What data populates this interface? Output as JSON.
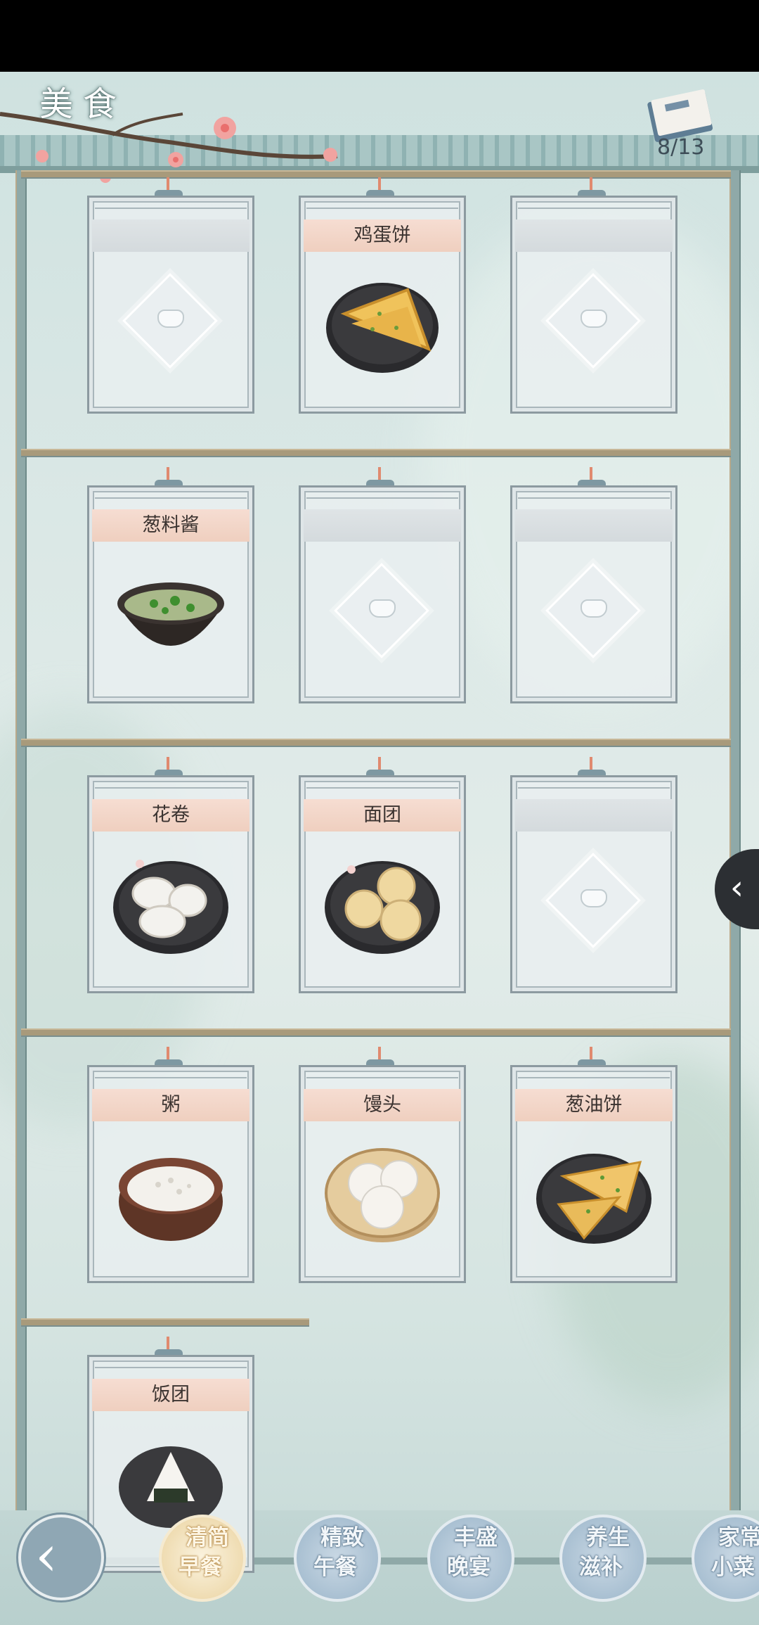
{
  "header": {
    "title": "美食",
    "progress": "8/13"
  },
  "cards": [
    {
      "name": "",
      "dish": "unknown"
    },
    {
      "name": "鸡蛋饼",
      "dish": "egg-pancake"
    },
    {
      "name": "",
      "dish": "unknown"
    },
    {
      "name": "葱料酱",
      "dish": "scallion-sauce"
    },
    {
      "name": "",
      "dish": "unknown"
    },
    {
      "name": "",
      "dish": "unknown"
    },
    {
      "name": "花卷",
      "dish": "flower-roll"
    },
    {
      "name": "面团",
      "dish": "dough"
    },
    {
      "name": "",
      "dish": "unknown"
    },
    {
      "name": "粥",
      "dish": "porridge"
    },
    {
      "name": "馒头",
      "dish": "steamed-bun"
    },
    {
      "name": "葱油饼",
      "dish": "scallion-pancake"
    },
    {
      "name": "饭团",
      "dish": "rice-ball"
    }
  ],
  "side_tab": {
    "icon": "chevron-left-icon"
  },
  "nav": {
    "back_icon": "back-arrow-icon",
    "tabs": [
      {
        "line1": "清简",
        "line2": "早餐",
        "selected": true
      },
      {
        "line1": "精致",
        "line2": "午餐",
        "selected": false
      },
      {
        "line1": "丰盛",
        "line2": "晚宴",
        "selected": false
      },
      {
        "line1": "养生",
        "line2": "滋补",
        "selected": false
      },
      {
        "line1": "家常",
        "line2": "小菜",
        "selected": false
      }
    ]
  },
  "colors": {
    "label_bg": "#f3d7ca",
    "frame": "#8c9aa0",
    "selected_tab": "#efdcb2",
    "tab": "#a9c0d2"
  }
}
